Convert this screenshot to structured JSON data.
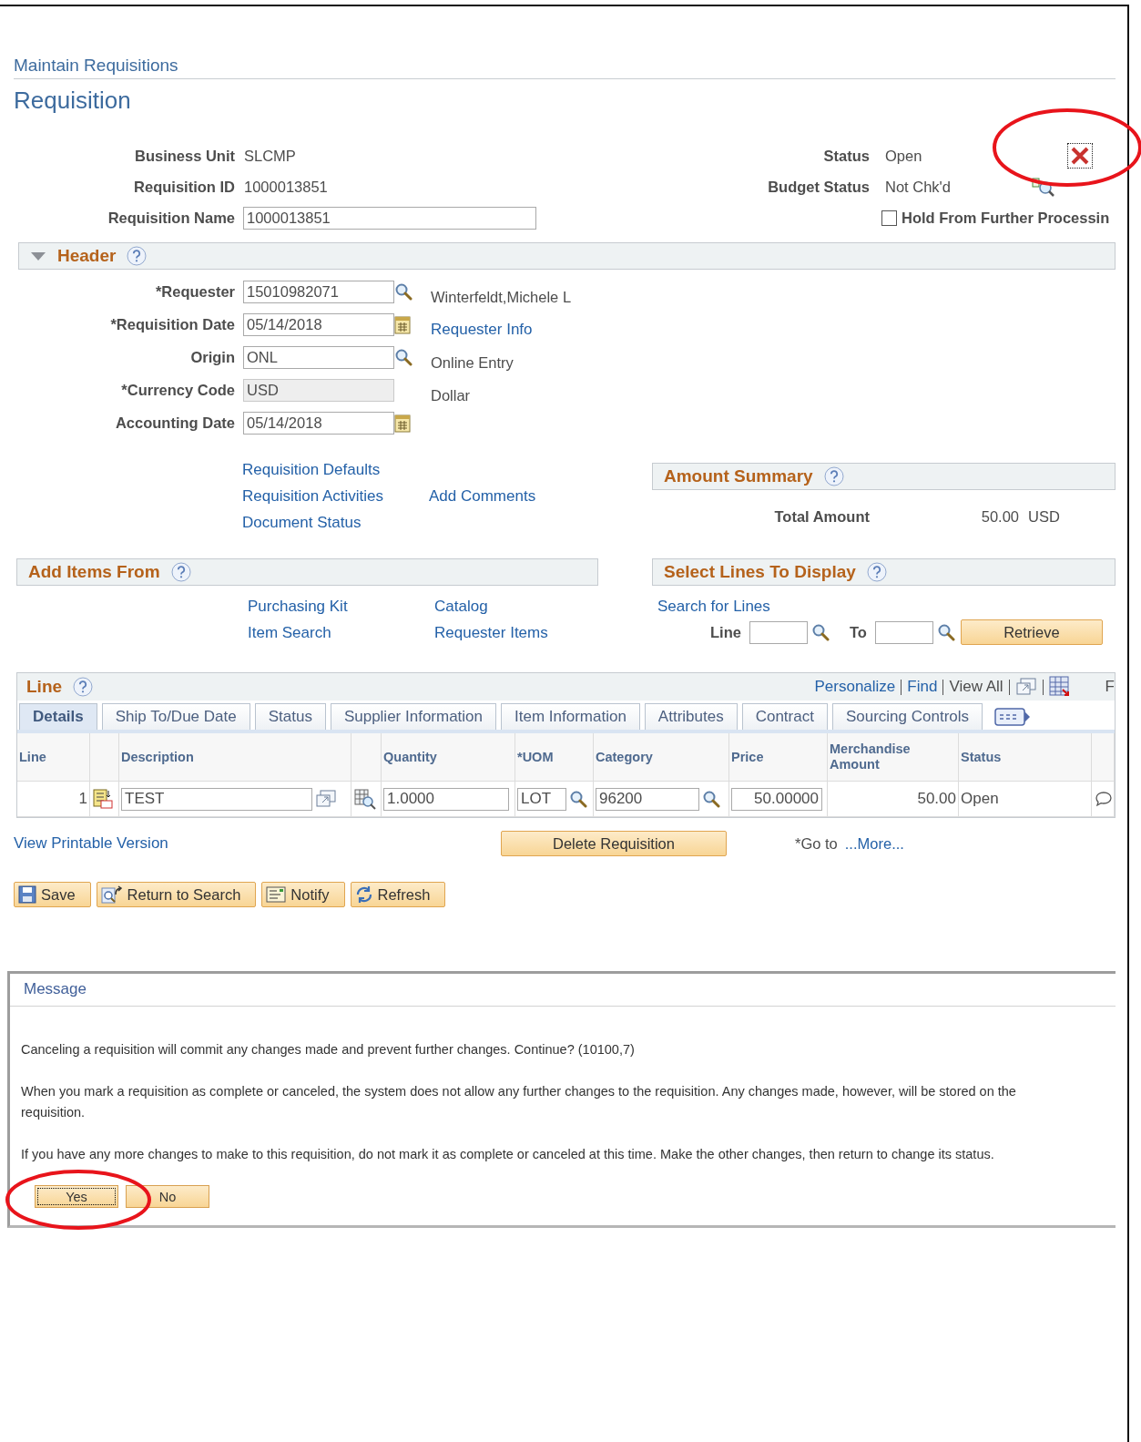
{
  "breadcrumb": "Maintain Requisitions",
  "title": "Requisition",
  "info_left": [
    {
      "label": "Business Unit",
      "value": "SLCMP",
      "kind": "text"
    },
    {
      "label": "Requisition ID",
      "value": "1000013851",
      "kind": "text"
    },
    {
      "label": "Requisition Name",
      "value": "1000013851",
      "kind": "input"
    }
  ],
  "info_right": [
    {
      "label": "Status",
      "value": "Open"
    },
    {
      "label": "Budget Status",
      "value": "Not Chk'd"
    }
  ],
  "hold": {
    "label": "Hold From Further Processin",
    "checked": false
  },
  "header": {
    "title": "Header",
    "expanded": true
  },
  "fields": [
    {
      "label": "*Requester",
      "value": "15010982071",
      "kind": "lookup",
      "note": "Winterfeldt,Michele L"
    },
    {
      "label": "*Requisition Date",
      "value": "05/14/2018",
      "kind": "date",
      "link": "Requester Info"
    },
    {
      "label": "Origin",
      "value": "ONL",
      "kind": "lookup",
      "note": "Online Entry"
    },
    {
      "label": "*Currency Code",
      "value": "USD",
      "kind": "readonly",
      "note": "Dollar"
    },
    {
      "label": "Accounting Date",
      "value": "05/14/2018",
      "kind": "date"
    }
  ],
  "header_link_columns": [
    [
      "Requisition Defaults",
      "Requisition Activities",
      "Document Status"
    ],
    [
      "Add Comments"
    ]
  ],
  "amount_summary": {
    "title": "Amount Summary",
    "label": "Total Amount",
    "value": "50.00",
    "currency": "USD"
  },
  "add_items": {
    "title": "Add Items From",
    "link_columns": [
      [
        "Purchasing Kit",
        "Item Search"
      ],
      [
        "Catalog",
        "Requester Items"
      ]
    ]
  },
  "select_lines": {
    "title": "Select Lines To Display",
    "link": "Search for Lines",
    "from_label": "Line",
    "to_label": "To",
    "button": "Retrieve"
  },
  "line_grid": {
    "title": "Line",
    "tools": [
      {
        "kind": "link",
        "label": "Personalize"
      },
      {
        "kind": "link",
        "label": "Find"
      },
      {
        "kind": "text",
        "label": "View All"
      },
      {
        "kind": "zoom"
      },
      {
        "kind": "grid"
      }
    ],
    "cut_label": "F",
    "tabs": [
      {
        "label": "Details",
        "selected": true
      },
      {
        "label": "Ship To/Due Date",
        "selected": false
      },
      {
        "label": "Status",
        "selected": false
      },
      {
        "label": "Supplier Information",
        "selected": false
      },
      {
        "label": "Item Information",
        "selected": false
      },
      {
        "label": "Attributes",
        "selected": false
      },
      {
        "label": "Contract",
        "selected": false
      },
      {
        "label": "Sourcing Controls",
        "selected": false
      }
    ],
    "columns": [
      {
        "kind": "text",
        "label": "Line"
      },
      {
        "kind": "icon"
      },
      {
        "kind": "text",
        "label": "Description"
      },
      {
        "kind": "icon"
      },
      {
        "kind": "text",
        "label": "Quantity"
      },
      {
        "kind": "text",
        "label": "*UOM"
      },
      {
        "kind": "text",
        "label": "Category"
      },
      {
        "kind": "text",
        "label": "Price"
      },
      {
        "kind": "text",
        "label": "Merchandise Amount"
      },
      {
        "kind": "text",
        "label": "Status"
      },
      {
        "kind": "icon"
      }
    ],
    "rows": [
      {
        "line": "1",
        "description": "TEST",
        "quantity": "1.0000",
        "uom": "LOT",
        "category": "96200",
        "price": "50.00000",
        "merchandise_amount": "50.00",
        "status": "Open"
      }
    ]
  },
  "view_printable": "View Printable Version",
  "delete_button": "Delete Requisition",
  "goto_label": "*Go to",
  "goto_link": "...More...",
  "toolbar": [
    {
      "label": "Save",
      "kind": "save"
    },
    {
      "label": "Return to Search",
      "kind": "return"
    },
    {
      "label": "Notify",
      "kind": "notify"
    },
    {
      "label": "Refresh",
      "kind": "refresh"
    }
  ],
  "message": {
    "title": "Message",
    "paragraphs": [
      "Canceling a requisition will commit any changes made and prevent further changes.  Continue? (10100,7)",
      "When you mark a requisition as complete or canceled, the system does not allow any further changes to the requisition.  Any changes made, however, will be stored on the requisition.",
      "If you have any more changes to make to this requisition, do not mark it as complete or canceled at this time.  Make the other changes, then return to change its status."
    ],
    "buttons": [
      {
        "label": "Yes",
        "focused": true
      },
      {
        "label": "No",
        "focused": false
      }
    ]
  }
}
